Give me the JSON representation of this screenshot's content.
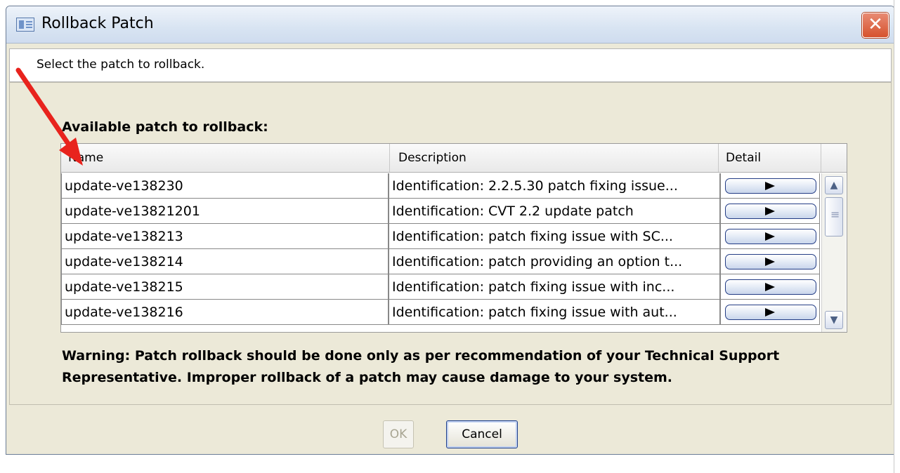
{
  "window": {
    "title": "Rollback Patch",
    "close_icon": "close-icon"
  },
  "header": {
    "instruction": "Select the patch to rollback."
  },
  "section": {
    "label": "Available patch to rollback:"
  },
  "table": {
    "columns": [
      "Name",
      "Description",
      "Detail"
    ],
    "rows": [
      {
        "name": "update-ve138230",
        "description": "Identification: 2.2.5.30 patch fixing issue..."
      },
      {
        "name": "update-ve13821201",
        "description": "Identification: CVT 2.2 update patch"
      },
      {
        "name": "update-ve138213",
        "description": "Identification: patch fixing issue with SC..."
      },
      {
        "name": "update-ve138214",
        "description": "Identification: patch providing an option t..."
      },
      {
        "name": "update-ve138215",
        "description": "Identification: patch fixing issue with inc..."
      },
      {
        "name": "update-ve138216",
        "description": "Identification: patch fixing issue with aut..."
      }
    ]
  },
  "warning": {
    "text": "Warning: Patch rollback should be done only as per recommendation of your Technical Support Representative. Improper rollback of a patch may cause damage to your system."
  },
  "buttons": {
    "ok": "OK",
    "cancel": "Cancel"
  },
  "colors": {
    "annotation_arrow": "#e8231d",
    "close_button": "#d6522e"
  }
}
